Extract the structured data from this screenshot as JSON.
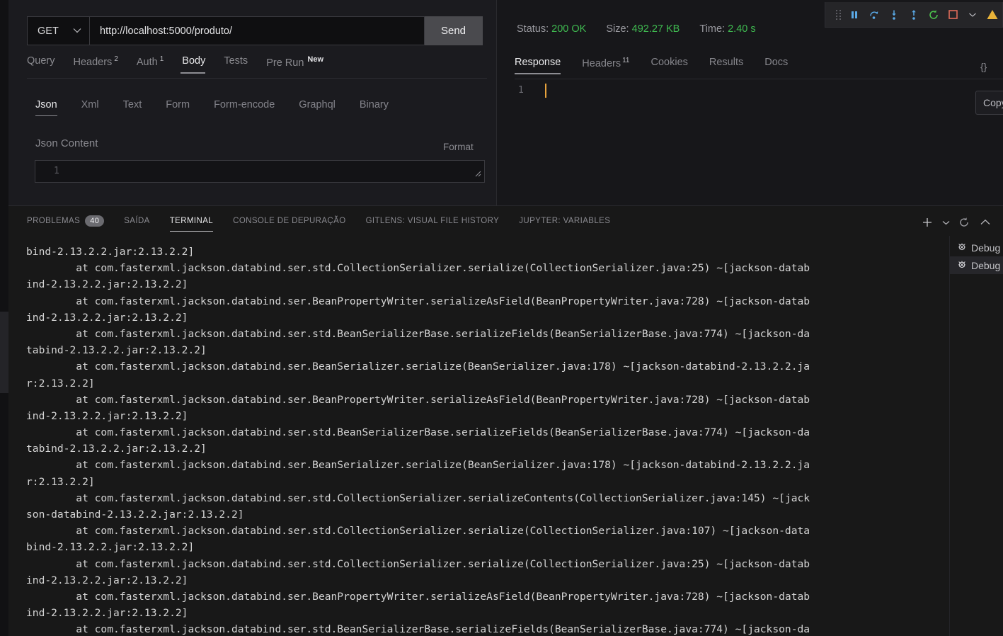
{
  "request": {
    "method": "GET",
    "method_icon": "chevron-down-icon",
    "url": "http://localhost:5000/produto/",
    "send_label": "Send",
    "tabs": [
      {
        "label": "Query",
        "sup": "",
        "badge": "",
        "active": false
      },
      {
        "label": "Headers",
        "sup": "2",
        "badge": "",
        "active": false
      },
      {
        "label": "Auth",
        "sup": "1",
        "badge": "",
        "active": false
      },
      {
        "label": "Body",
        "sup": "",
        "badge": "",
        "active": true
      },
      {
        "label": "Tests",
        "sup": "",
        "badge": "",
        "active": false
      },
      {
        "label": "Pre Run",
        "sup": "",
        "badge": "New",
        "active": false
      }
    ],
    "body_tabs": [
      {
        "label": "Json",
        "active": true
      },
      {
        "label": "Xml",
        "active": false
      },
      {
        "label": "Text",
        "active": false
      },
      {
        "label": "Form",
        "active": false
      },
      {
        "label": "Form-encode",
        "active": false
      },
      {
        "label": "Graphql",
        "active": false
      },
      {
        "label": "Binary",
        "active": false
      }
    ],
    "json_content_label": "Json Content",
    "format_label": "Format",
    "json_editor_line": "1"
  },
  "response": {
    "status_label": "Status:",
    "status_value": "200 OK",
    "size_label": "Size:",
    "size_value": "492.27 KB",
    "time_label": "Time:",
    "time_value": "2.40 s",
    "status_color": "#3fb950",
    "tabs": [
      {
        "label": "Response",
        "sup": "",
        "active": true
      },
      {
        "label": "Headers",
        "sup": "11",
        "active": false
      },
      {
        "label": "Cookies",
        "sup": "",
        "active": false
      },
      {
        "label": "Results",
        "sup": "",
        "active": false
      },
      {
        "label": "Docs",
        "sup": "",
        "active": false
      }
    ],
    "braces_label": "{}",
    "editor_line_number": "1",
    "copy_label": "Copy"
  },
  "debug_toolbar": {
    "buttons": [
      {
        "name": "drag-handle-icon",
        "title": ""
      },
      {
        "name": "pause-icon",
        "color": "#5aa9e6"
      },
      {
        "name": "step-over-icon",
        "color": "#5aa9e6"
      },
      {
        "name": "step-into-icon",
        "color": "#5aa9e6"
      },
      {
        "name": "step-out-icon",
        "color": "#5aa9e6"
      },
      {
        "name": "restart-icon",
        "color": "#4ec94e"
      },
      {
        "name": "stop-icon",
        "color": "#e26d5a"
      },
      {
        "name": "chevron-down-icon",
        "color": "#b5b5ba"
      },
      {
        "name": "warning-icon",
        "color": "#e8b339"
      }
    ]
  },
  "panel": {
    "tabs": [
      {
        "label": "PROBLEMAS",
        "badge": "40",
        "active": false
      },
      {
        "label": "SAÍDA",
        "badge": "",
        "active": false
      },
      {
        "label": "TERMINAL",
        "badge": "",
        "active": true
      },
      {
        "label": "CONSOLE DE DEPURAÇÃO",
        "badge": "",
        "active": false
      },
      {
        "label": "GITLENS: VISUAL FILE HISTORY",
        "badge": "",
        "active": false
      },
      {
        "label": "JUPYTER: VARIABLES",
        "badge": "",
        "active": false
      }
    ],
    "actions": [
      {
        "name": "add-terminal-icon",
        "glyph": "+"
      },
      {
        "name": "chevron-down-icon",
        "glyph": "⌄"
      },
      {
        "name": "refresh-icon",
        "glyph": "↻"
      },
      {
        "name": "collapse-panel-icon",
        "glyph": "⌃"
      }
    ],
    "terminal_list": [
      {
        "label": "Debug",
        "icon": "debug-bug-icon",
        "selected": false
      },
      {
        "label": "Debug",
        "icon": "debug-bug-icon",
        "selected": true
      }
    ],
    "terminal_lines": [
      "bind-2.13.2.2.jar:2.13.2.2]",
      "        at com.fasterxml.jackson.databind.ser.std.CollectionSerializer.serialize(CollectionSerializer.java:25) ~[jackson-datab",
      "ind-2.13.2.2.jar:2.13.2.2]",
      "        at com.fasterxml.jackson.databind.ser.BeanPropertyWriter.serializeAsField(BeanPropertyWriter.java:728) ~[jackson-datab",
      "ind-2.13.2.2.jar:2.13.2.2]",
      "        at com.fasterxml.jackson.databind.ser.std.BeanSerializerBase.serializeFields(BeanSerializerBase.java:774) ~[jackson-da",
      "tabind-2.13.2.2.jar:2.13.2.2]",
      "        at com.fasterxml.jackson.databind.ser.BeanSerializer.serialize(BeanSerializer.java:178) ~[jackson-databind-2.13.2.2.ja",
      "r:2.13.2.2]",
      "        at com.fasterxml.jackson.databind.ser.BeanPropertyWriter.serializeAsField(BeanPropertyWriter.java:728) ~[jackson-datab",
      "ind-2.13.2.2.jar:2.13.2.2]",
      "        at com.fasterxml.jackson.databind.ser.std.BeanSerializerBase.serializeFields(BeanSerializerBase.java:774) ~[jackson-da",
      "tabind-2.13.2.2.jar:2.13.2.2]",
      "        at com.fasterxml.jackson.databind.ser.BeanSerializer.serialize(BeanSerializer.java:178) ~[jackson-databind-2.13.2.2.ja",
      "r:2.13.2.2]",
      "        at com.fasterxml.jackson.databind.ser.std.CollectionSerializer.serializeContents(CollectionSerializer.java:145) ~[jack",
      "son-databind-2.13.2.2.jar:2.13.2.2]",
      "        at com.fasterxml.jackson.databind.ser.std.CollectionSerializer.serialize(CollectionSerializer.java:107) ~[jackson-data",
      "bind-2.13.2.2.jar:2.13.2.2]",
      "        at com.fasterxml.jackson.databind.ser.std.CollectionSerializer.serialize(CollectionSerializer.java:25) ~[jackson-datab",
      "ind-2.13.2.2.jar:2.13.2.2]",
      "        at com.fasterxml.jackson.databind.ser.BeanPropertyWriter.serializeAsField(BeanPropertyWriter.java:728) ~[jackson-datab",
      "ind-2.13.2.2.jar:2.13.2.2]",
      "        at com.fasterxml.jackson.databind.ser.std.BeanSerializerBase.serializeFields(BeanSerializerBase.java:774) ~[jackson-da"
    ]
  }
}
